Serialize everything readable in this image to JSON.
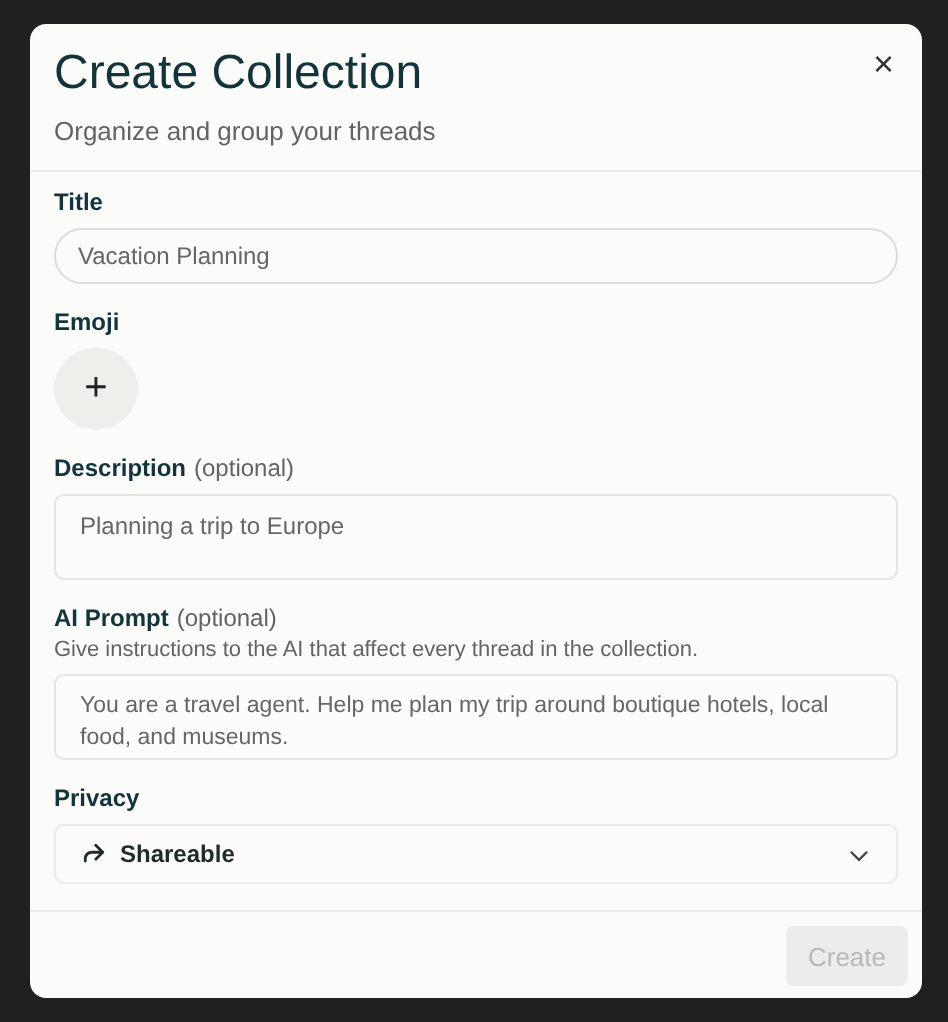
{
  "dialog": {
    "title": "Create Collection",
    "subtitle": "Organize and group your threads",
    "close": "×"
  },
  "fields": [
    {
      "kind": "input",
      "label": "Title",
      "placeholder": "Vacation Planning"
    },
    {
      "kind": "emoji",
      "label": "Emoji",
      "button": "+"
    },
    {
      "kind": "textarea",
      "label": "Description",
      "optional": "(optional)",
      "placeholder": "Planning a trip to Europe"
    },
    {
      "kind": "textarea",
      "label": "AI Prompt",
      "optional": "(optional)",
      "hint": "Give instructions to the AI that affect every thread in the collection.",
      "placeholder": "You are a travel agent. Help me plan my trip around boutique hotels, local food, and museums."
    },
    {
      "kind": "select",
      "label": "Privacy",
      "value": "Shareable"
    }
  ],
  "footer": {
    "button": {
      "label": "Create",
      "disabled": true
    }
  }
}
